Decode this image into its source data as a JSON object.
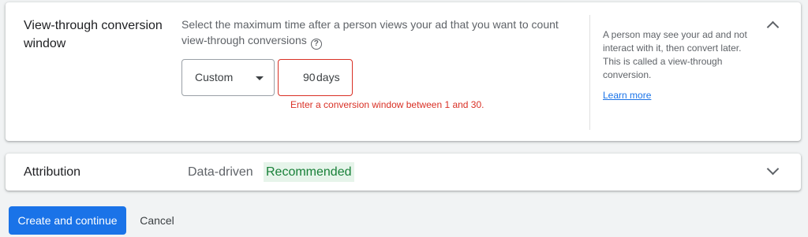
{
  "conversion_window": {
    "title": "View-through conversion window",
    "description": "Select the maximum time after a person views your ad that you want to count view-through conversions",
    "help_icon": "help-circle-icon",
    "select": {
      "selected": "Custom"
    },
    "days_input": {
      "value": "90",
      "suffix": "days"
    },
    "error": "Enter a conversion window between 1 and 30.",
    "side_note": "A person may see your ad and not interact with it, then convert later. This is called a view-through conversion.",
    "learn_more": "Learn more",
    "collapse_icon": "chevron-up-icon"
  },
  "attribution": {
    "title": "Attribution",
    "value": "Data-driven",
    "badge": "Recommended",
    "expand_icon": "chevron-down-icon"
  },
  "actions": {
    "primary": "Create and continue",
    "cancel": "Cancel"
  },
  "colors": {
    "accent": "#1a73e8",
    "error": "#d93025",
    "badge_text": "#188038",
    "badge_bg": "#e6f4ea",
    "page_bg": "#f1f3f4"
  }
}
